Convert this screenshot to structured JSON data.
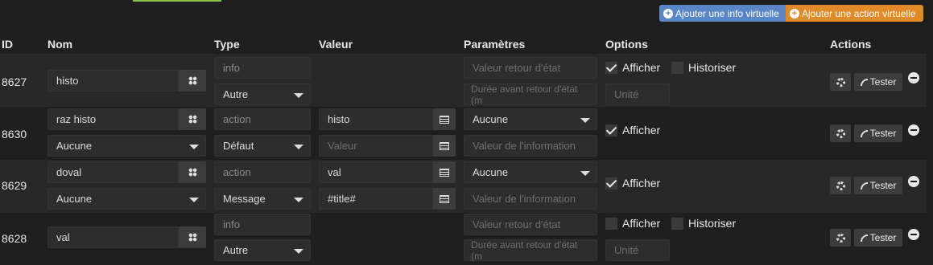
{
  "toolbar": {
    "add_info_label": "Ajouter une info virtuelle",
    "add_action_label": "Ajouter une action virtuelle"
  },
  "headers": {
    "id": "ID",
    "nom": "Nom",
    "type": "Type",
    "valeur": "Valeur",
    "parametres": "Paramètres",
    "options": "Options",
    "actions": "Actions"
  },
  "common": {
    "tester": "Tester",
    "afficher": "Afficher",
    "historiser": "Historiser",
    "unite_placeholder": "Unité",
    "valeur_retour_placeholder": "Valeur retour d'état",
    "duree_placeholder": "Durée avant retour d'état (m",
    "valeur_placeholder": "Valeur",
    "valeur_info_placeholder": "Valeur de l'information"
  },
  "rows": [
    {
      "id": "8627",
      "name": "histo",
      "type": "info",
      "subtype": "Autre",
      "afficher": true,
      "historiser": false
    },
    {
      "id": "8630",
      "name": "raz histo",
      "type": "action",
      "subtype": "Défaut",
      "generic": "Aucune",
      "value": "histo",
      "param": "Aucune",
      "afficher": true
    },
    {
      "id": "8629",
      "name": "doval",
      "type": "action",
      "subtype": "Message",
      "generic": "Aucune",
      "value": "val",
      "value2": "#title#",
      "param": "Aucune",
      "afficher": true
    },
    {
      "id": "8628",
      "name": "val",
      "type": "info",
      "subtype": "Autre",
      "afficher": false,
      "historiser": false
    }
  ],
  "colors": {
    "info_button": "#5a86c6",
    "action_button": "#e08a2a",
    "background": "#1f1f1f"
  }
}
